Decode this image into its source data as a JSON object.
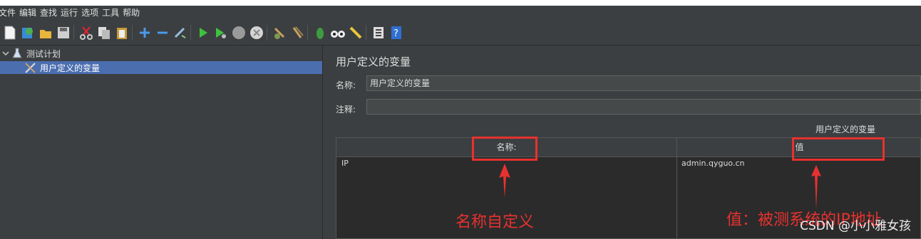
{
  "menubar": {
    "items": [
      "文件",
      "编辑",
      "查找",
      "运行",
      "选项",
      "工具",
      "帮助"
    ]
  },
  "toolbar": {
    "icons": [
      "new-icon",
      "templates-icon",
      "open-icon",
      "save-icon",
      "cut-icon",
      "copy-icon",
      "paste-icon",
      "add-icon",
      "remove-icon",
      "browse-icon",
      "start-icon",
      "start-no-pause-icon",
      "stop-icon",
      "shutdown-icon",
      "clear-icon",
      "clear-all-icon",
      "search-icon",
      "binoculars-icon",
      "reset-search-icon",
      "function-helper-icon",
      "help-icon"
    ]
  },
  "tree": {
    "root_label": "测试计划",
    "child_label": "用户定义的变量"
  },
  "panel": {
    "title": "用户定义的变量",
    "name_label": "名称:",
    "name_value": "用户定义的变量",
    "comment_label": "注释:",
    "comment_value": ""
  },
  "table": {
    "caption": "用户定义的变量",
    "headers": [
      "名称:",
      "值"
    ],
    "rows": [
      {
        "name": "IP",
        "value": "admin.qyguo.cn"
      }
    ]
  },
  "annotations": {
    "left": "名称自定义",
    "right": "值：被测系统的IP地址"
  },
  "watermark": "CSDN @小小雅女孩",
  "colors": {
    "accent": "#e8312f",
    "selection": "#4b6eaf",
    "bg": "#3c3f41"
  }
}
